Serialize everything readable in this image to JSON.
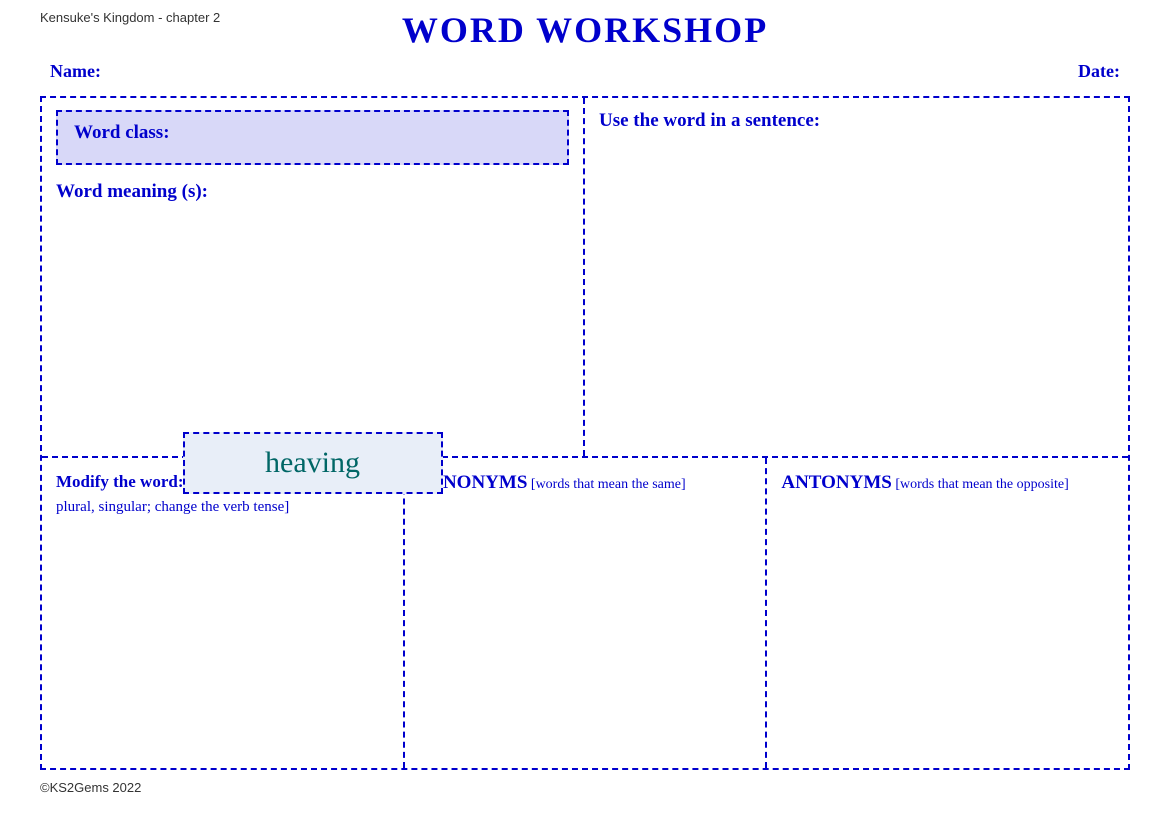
{
  "top_left": "Kensuke's Kingdom - chapter 2",
  "title": "WORD WORKSHOP",
  "name_label": "Name:",
  "date_label": "Date:",
  "word_class_label": "Word class:",
  "word_meaning_label": "Word meaning (s):",
  "use_word_label": "Use the word in a sentence:",
  "center_word": "heaving",
  "modify_bold": "Modify the word:",
  "modify_normal": " [add a prefix or a suffix or both; plural, singular; change the verb tense]",
  "synonyms_bold": "SYNONYMS",
  "synonyms_normal": " [words that mean the same]",
  "antonyms_bold": "ANTONYMS",
  "antonyms_normal": " [words that mean the opposite]",
  "footer": "©KS2Gems 2022"
}
